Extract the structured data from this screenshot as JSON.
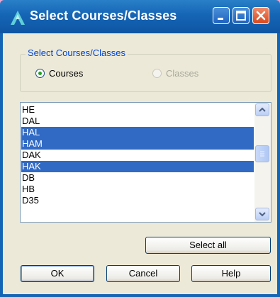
{
  "window": {
    "title": "Select Courses/Classes",
    "title_bar_color": "#1565b5",
    "controls": [
      "minimize-icon",
      "maximize-icon",
      "close-icon"
    ]
  },
  "group": {
    "legend": "Select Courses/Classes",
    "options": [
      {
        "label": "Courses",
        "checked": true,
        "enabled": true
      },
      {
        "label": "Classes",
        "checked": false,
        "enabled": false
      }
    ]
  },
  "list": {
    "items": [
      {
        "label": "HE",
        "selected": false
      },
      {
        "label": "DAL",
        "selected": false
      },
      {
        "label": "HAL",
        "selected": true
      },
      {
        "label": "HAM",
        "selected": true
      },
      {
        "label": "DAK",
        "selected": false
      },
      {
        "label": "HAK",
        "selected": true
      },
      {
        "label": "DB",
        "selected": false
      },
      {
        "label": "HB",
        "selected": false
      },
      {
        "label": "D35",
        "selected": false
      }
    ],
    "selection_color": "#316ac5"
  },
  "buttons": {
    "select_all": "Select all",
    "ok": "OK",
    "cancel": "Cancel",
    "help": "Help"
  }
}
